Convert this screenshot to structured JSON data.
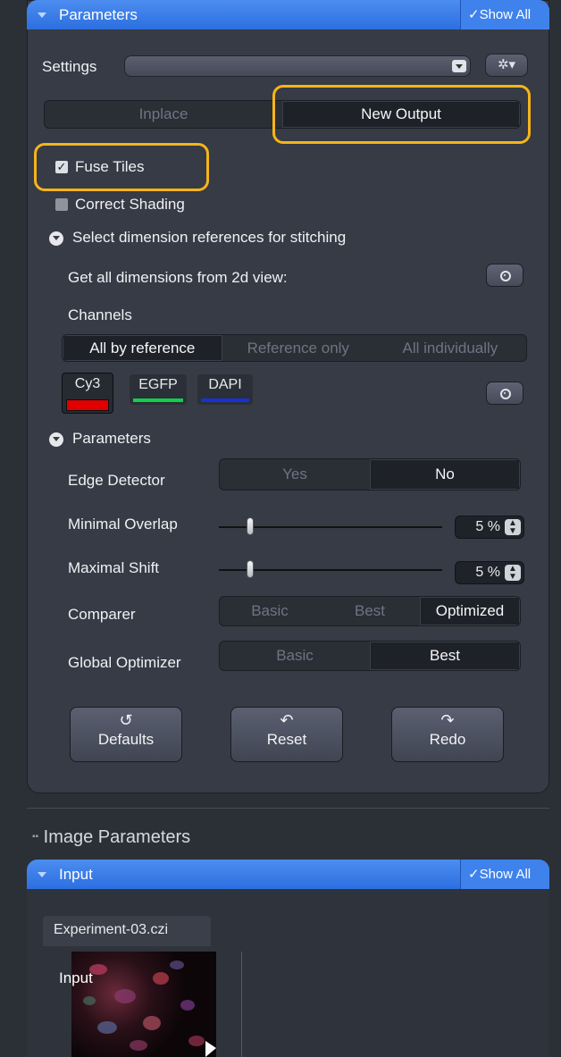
{
  "parameters_panel": {
    "header_title": "Parameters",
    "show_all": "Show All",
    "settings_label": "Settings",
    "settings_value": "",
    "output_mode": {
      "options": [
        "Inplace",
        "New Output"
      ],
      "selected": "New Output"
    },
    "fuse_tiles": {
      "label": "Fuse Tiles",
      "checked": true
    },
    "correct_shading": {
      "label": "Correct Shading",
      "checked": false
    },
    "dim_section": {
      "title": "Select dimension references for stitching",
      "get_all_label": "Get all dimensions from 2d view:",
      "channels_label": "Channels",
      "channel_mode": {
        "options": [
          "All by reference",
          "Reference only",
          "All individually"
        ],
        "selected": "All by reference"
      },
      "channels": [
        {
          "name": "Cy3",
          "color": "#e00000"
        },
        {
          "name": "EGFP",
          "color": "#11d04a"
        },
        {
          "name": "DAPI",
          "color": "#1830d8"
        }
      ]
    },
    "params_section": {
      "title": "Parameters",
      "edge_detector": {
        "label": "Edge Detector",
        "options": [
          "Yes",
          "No"
        ],
        "selected": "No"
      },
      "minimal_overlap": {
        "label": "Minimal Overlap",
        "value": "5 %",
        "slider_fraction": 0.05
      },
      "maximal_shift": {
        "label": "Maximal Shift",
        "value": "5 %",
        "slider_fraction": 0.05
      },
      "comparer": {
        "label": "Comparer",
        "options": [
          "Basic",
          "Best",
          "Optimized"
        ],
        "selected": "Optimized"
      },
      "global_optimizer": {
        "label": "Global Optimizer",
        "options": [
          "Basic",
          "Best"
        ],
        "selected": "Best"
      }
    },
    "buttons": {
      "defaults": "Defaults",
      "reset": "Reset",
      "redo": "Redo"
    }
  },
  "image_parameters": {
    "section_title": "Image Parameters",
    "input_header": "Input",
    "show_all": "Show All",
    "file_name": "Experiment-03.czi",
    "thumb_label": "Input"
  },
  "highlight_color": "#f5b51a"
}
